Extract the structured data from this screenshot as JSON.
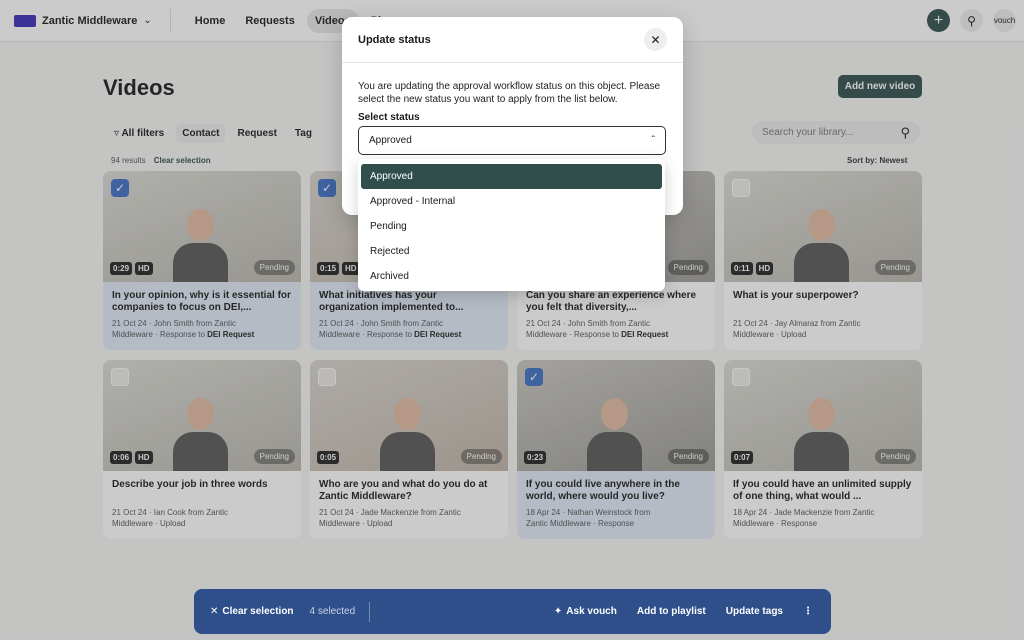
{
  "topbar": {
    "brand": "Zantic Middleware",
    "nav": [
      "Home",
      "Requests",
      "Videos",
      "Pl"
    ],
    "active_nav": "Videos",
    "user": "vouch"
  },
  "page": {
    "title": "Videos",
    "add_button": "Add new video",
    "filters": {
      "all": "All filters",
      "contact": "Contact",
      "request": "Request",
      "tag": "Tag"
    },
    "search_placeholder": "Search your library...",
    "results": "94 results",
    "clear_selection": "Clear selection",
    "sort": "Sort by: Newest"
  },
  "cards": [
    {
      "duration": "0:29",
      "hd": "HD",
      "status": "Pending",
      "selected": true,
      "title": "In your opinion, why is it essential for companies to focus on DEI,...",
      "meta1": "21 Oct 24 · John Smith from Zantic",
      "meta2": "Middleware · Response to ",
      "meta_bold": "DEI Request"
    },
    {
      "duration": "0:15",
      "hd": "HD",
      "status": "Pending",
      "selected": true,
      "title": "What initiatives has your organization implemented to...",
      "meta1": "21 Oct 24 · John Smith from Zantic",
      "meta2": "Middleware · Response to ",
      "meta_bold": "DEI Request"
    },
    {
      "duration": "",
      "hd": "",
      "status": "Pending",
      "selected": false,
      "title": "Can you share an experience where you felt that diversity,...",
      "meta1": "21 Oct 24 · John Smith from Zantic",
      "meta2": "Middleware · Response to ",
      "meta_bold": "DEI Request"
    },
    {
      "duration": "0:11",
      "hd": "HD",
      "status": "Pending",
      "selected": false,
      "title": "What is your superpower?",
      "meta1": "21 Oct 24 · Jay Almaraz from Zantic",
      "meta2": "Middleware · Upload",
      "meta_bold": ""
    },
    {
      "duration": "0:06",
      "hd": "HD",
      "status": "Pending",
      "selected": false,
      "title": "Describe your job in three words",
      "meta1": "21 Oct 24 · Ian Cook from Zantic",
      "meta2": "Middleware · Upload",
      "meta_bold": ""
    },
    {
      "duration": "0:05",
      "hd": "",
      "status": "Pending",
      "selected": false,
      "title": "Who are you and what do you do at Zantic Middleware?",
      "meta1": "21 Oct 24 · Jade Mackenzie from Zantic",
      "meta2": "Middleware · Upload",
      "meta_bold": ""
    },
    {
      "duration": "0:23",
      "hd": "",
      "status": "Pending",
      "selected": true,
      "title": "If you could live anywhere in the world, where would you live?",
      "meta1": "18 Apr 24 · Nathan Weinstock from",
      "meta2": "Zantic Middleware · Response",
      "meta_bold": ""
    },
    {
      "duration": "0:07",
      "hd": "",
      "status": "Pending",
      "selected": false,
      "title": "If you could have an unlimited supply of one thing, what would ...",
      "meta1": "18 Apr 24 · Jade Mackenzie from Zantic",
      "meta2": "Middleware · Response",
      "meta_bold": ""
    }
  ],
  "modal": {
    "title": "Update status",
    "description": "You are updating the approval workflow status on this object. Please select the new status you want to apply from the list below.",
    "select_label": "Select status",
    "selected_value": "Approved",
    "options": [
      "Approved",
      "Approved - Internal",
      "Pending",
      "Rejected",
      "Archived"
    ]
  },
  "action_bar": {
    "clear": "Clear selection",
    "count": "4 selected",
    "ask": "Ask vouch",
    "playlist": "Add to playlist",
    "tags": "Update tags"
  },
  "colors": {
    "accent": "#2f4e4c",
    "selection": "#3c6fc4",
    "action_bar": "#2e4f8a"
  }
}
